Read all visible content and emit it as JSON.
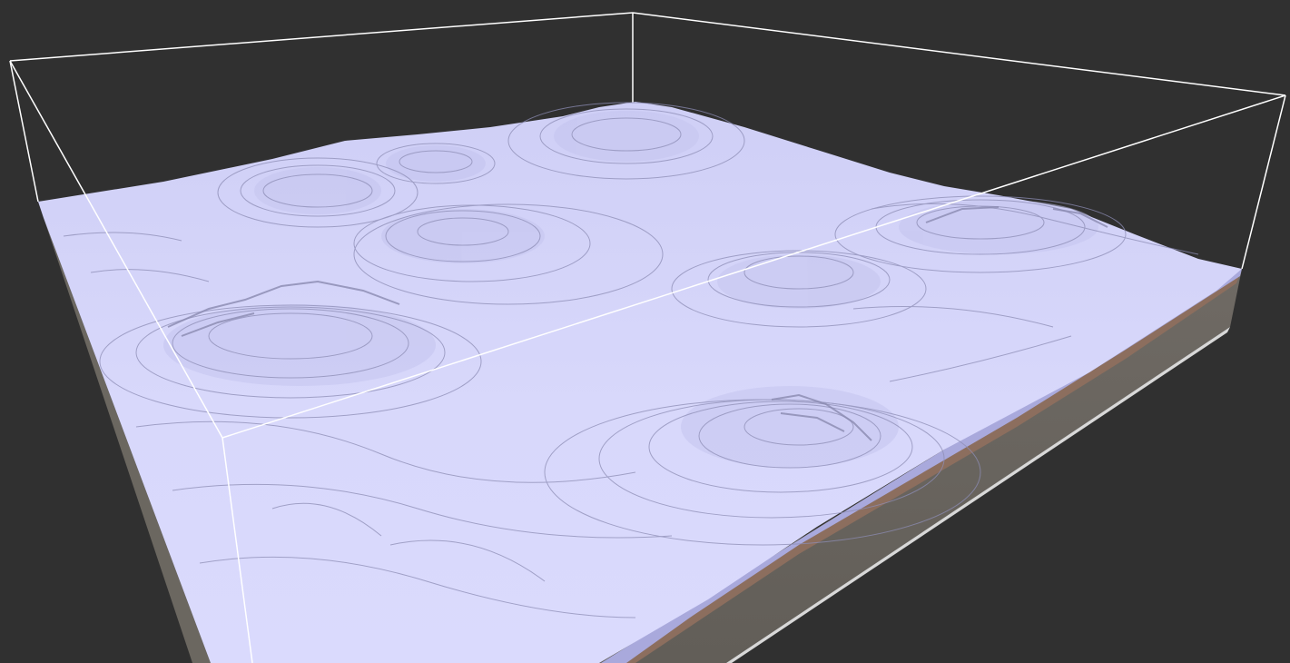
{
  "scene": {
    "kind": "3d-voxel-terrain-viewport",
    "colors": {
      "background": "#303030",
      "snow_surface": "#d6d6fb",
      "snow_shadow": "#b9b9e6",
      "contour_line": "#8888aa",
      "dirt_layer": "#8c6e5e",
      "stone_side": "#6a6660",
      "bounding_box": "#ffffff"
    }
  }
}
